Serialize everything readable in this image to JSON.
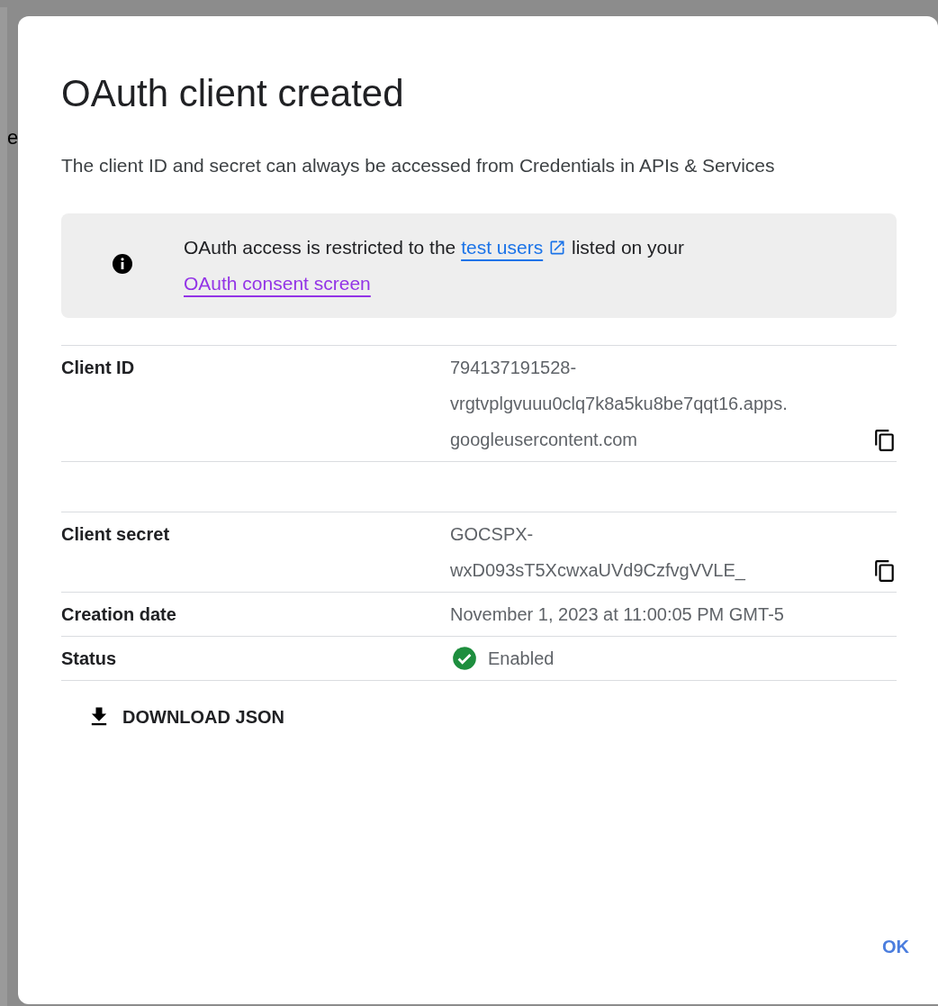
{
  "background_page": {
    "fragment": "e"
  },
  "dialog": {
    "title": "OAuth client created",
    "description": "The client ID and secret can always be accessed from Credentials in APIs & Services",
    "notice": {
      "before": "OAuth access is restricted to the ",
      "link_1": "test users",
      "middle": " listed on your",
      "link_2": "OAuth consent screen"
    },
    "details": [
      {
        "kind": "copyable",
        "label": "Client ID",
        "value_lines": [
          "794137191528-",
          "vrgtvplgvuuu0clq7k8a5ku8be7qqt16.apps.",
          "googleusercontent.com"
        ]
      },
      {
        "kind": "spacer"
      },
      {
        "kind": "copyable",
        "label": "Client secret",
        "value_lines": [
          "GOCSPX-",
          "wxD093sT5XcwxaUVd9CzfvgVVLE_"
        ]
      },
      {
        "kind": "text",
        "label": "Creation date",
        "value_lines": [
          "November 1, 2023 at 11:00:05 PM GMT-5"
        ]
      },
      {
        "kind": "status",
        "label": "Status",
        "value_lines": [
          "Enabled"
        ]
      }
    ],
    "download_button": "DOWNLOAD JSON",
    "ok_button": "OK"
  }
}
